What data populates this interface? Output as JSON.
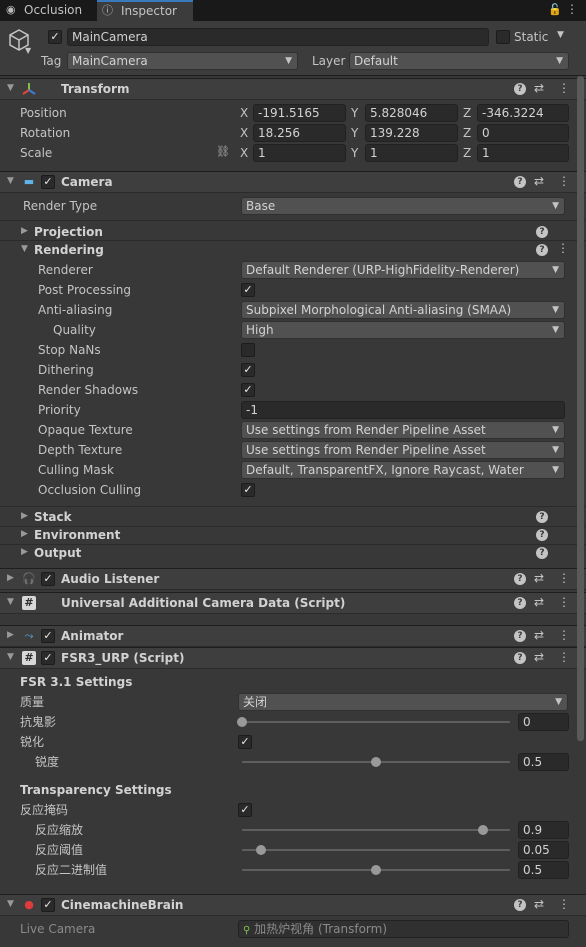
{
  "tabs": {
    "occlusion": "Occlusion",
    "inspector": "Inspector"
  },
  "gameobject": {
    "name": "MainCamera",
    "static_label": "Static",
    "tag_label": "Tag",
    "tag_value": "MainCamera",
    "layer_label": "Layer",
    "layer_value": "Default"
  },
  "transform": {
    "title": "Transform",
    "position_label": "Position",
    "rotation_label": "Rotation",
    "scale_label": "Scale",
    "x": "X",
    "y": "Y",
    "z": "Z",
    "position": [
      "-191.5165",
      "5.828046",
      "-346.3224"
    ],
    "rotation": [
      "18.256",
      "139.228",
      "0"
    ],
    "scale": [
      "1",
      "1",
      "1"
    ]
  },
  "camera": {
    "title": "Camera",
    "render_type_label": "Render Type",
    "render_type_value": "Base",
    "projection": "Projection",
    "rendering": "Rendering",
    "renderer_label": "Renderer",
    "renderer_value": "Default Renderer (URP-HighFidelity-Renderer)",
    "post_processing_label": "Post Processing",
    "anti_aliasing_label": "Anti-aliasing",
    "anti_aliasing_value": "Subpixel Morphological Anti-aliasing (SMAA)",
    "quality_label": "Quality",
    "quality_value": "High",
    "stop_nans_label": "Stop NaNs",
    "dithering_label": "Dithering",
    "render_shadows_label": "Render Shadows",
    "priority_label": "Priority",
    "priority_value": "-1",
    "opaque_texture_label": "Opaque Texture",
    "opaque_texture_value": "Use settings from Render Pipeline Asset",
    "depth_texture_label": "Depth Texture",
    "depth_texture_value": "Use settings from Render Pipeline Asset",
    "culling_mask_label": "Culling Mask",
    "culling_mask_value": "Default, TransparentFX, Ignore Raycast, Water",
    "occlusion_culling_label": "Occlusion Culling",
    "stack": "Stack",
    "environment": "Environment",
    "output": "Output"
  },
  "audio_listener": {
    "title": "Audio Listener"
  },
  "uacd": {
    "title": "Universal Additional Camera Data (Script)"
  },
  "animator": {
    "title": "Animator"
  },
  "fsr": {
    "title": "FSR3_URP (Script)",
    "settings_header": "FSR 3.1 Settings",
    "quality_label": "质量",
    "quality_value": "关闭",
    "antighost_label": "抗鬼影",
    "antighost_value": "0",
    "antighost_fraction": 0.0,
    "sharpen_label": "锐化",
    "sharpness_label": "锐度",
    "sharpness_value": "0.5",
    "sharpness_fraction": 0.5,
    "transparency_header": "Transparency Settings",
    "reactive_mask_label": "反应掩码",
    "reactive_scale_label": "反应缩放",
    "reactive_scale_value": "0.9",
    "reactive_scale_fraction": 0.9,
    "reactive_threshold_label": "反应阈值",
    "reactive_threshold_value": "0.05",
    "reactive_threshold_fraction": 0.07,
    "reactive_binary_label": "反应二进制值",
    "reactive_binary_value": "0.5",
    "reactive_binary_fraction": 0.5
  },
  "brain": {
    "title": "CinemachineBrain",
    "live_camera_label": "Live Camera",
    "live_camera_value": "加热炉视角 (Transform)"
  },
  "icons": [
    "cube-icon",
    "lock-icon",
    "kebab-menu-icon",
    "help-icon",
    "preset-icon",
    "menu-dots-icon",
    "transform-axes-icon",
    "camera-icon",
    "headphones-icon",
    "script-icon",
    "animator-icon",
    "cinemachine-icon"
  ],
  "colors": {
    "accent_tab": "#3a79bb",
    "panel": "#383838",
    "header": "#3e3e3e"
  }
}
